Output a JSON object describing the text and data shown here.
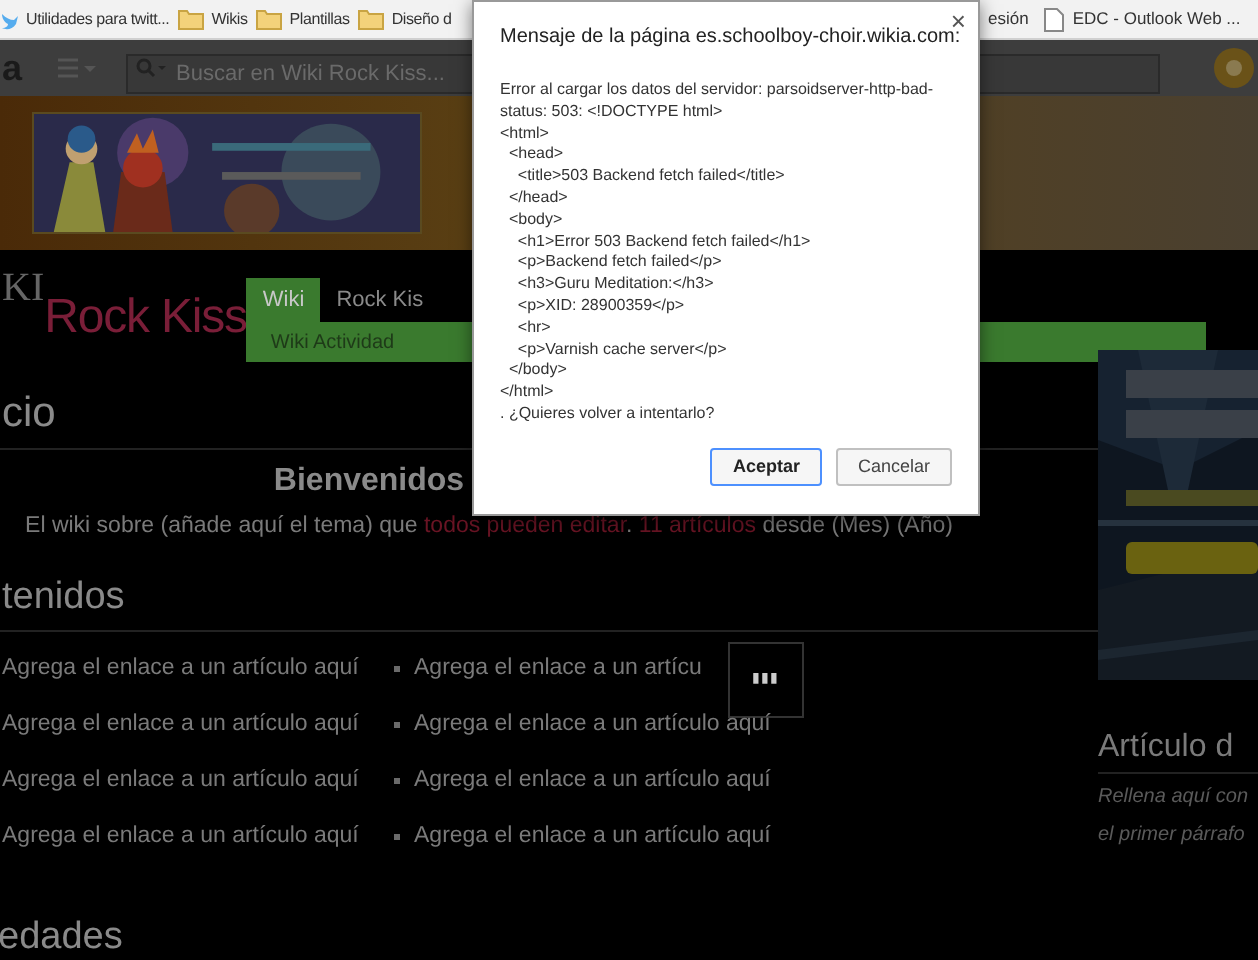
{
  "bookmarks": [
    {
      "kind": "bird",
      "label": "Utilidades para twitt..."
    },
    {
      "kind": "folder",
      "label": "Wikis"
    },
    {
      "kind": "folder",
      "label": "Plantillas"
    },
    {
      "kind": "folder",
      "label": "Diseño d"
    },
    {
      "kind": "text",
      "label": "esión"
    },
    {
      "kind": "page",
      "label": "EDC - Outlook Web ..."
    }
  ],
  "toolbar": {
    "logo": "a",
    "search": {
      "placeholder": "Buscar en Wiki Rock Kiss..."
    }
  },
  "wiki": {
    "logo_prefix": "KI",
    "logo": "Rock Kiss",
    "tabs": [
      {
        "label": "Wiki",
        "selected": true
      },
      {
        "label": "Rock Kis",
        "selected": false
      }
    ],
    "subnav": [
      "Wiki Actividad"
    ]
  },
  "page_title": "cio",
  "welcome": {
    "title": "Bienvenidos",
    "parts": [
      {
        "kind": "text",
        "text": "El wiki sobre (añade aquí el tema) que "
      },
      {
        "kind": "link",
        "text": "todos pueden editar"
      },
      {
        "kind": "text",
        "text": ". "
      },
      {
        "kind": "link",
        "text": "11 artículos"
      },
      {
        "kind": "text",
        "text": " desde (Mes) (Año)"
      }
    ]
  },
  "contents": {
    "heading": "tenidos",
    "column_1": [
      "Agrega el enlace a un artículo aquí",
      "Agrega el enlace a un artículo aquí",
      "Agrega el enlace a un artículo aquí",
      "Agrega el enlace a un artículo aquí"
    ],
    "column_2": [
      "Agrega el enlace a un artícu",
      "Agrega el enlace a un artículo aquí",
      "Agrega el enlace a un artículo aquí",
      "Agrega el enlace a un artículo aquí"
    ]
  },
  "loading": "▮▮▮",
  "news_heading": "edades",
  "sidebar": {
    "heading": "Artículo d",
    "lines": [
      "Rellena aquí con",
      "el primer párrafo"
    ]
  },
  "dialog": {
    "title": "Mensaje de la página es.schoolboy-choir.wikia.com:",
    "close": "×",
    "lines": [
      "Error al cargar los datos del servidor: parsoidserver-http-bad-status: 503: <!DOCTYPE html>",
      "<html>",
      "  <head>",
      "    <title>503 Backend fetch failed</title>",
      "  </head>",
      "  <body>",
      "    <h1>Error 503 Backend fetch failed</h1>",
      "    <p>Backend fetch failed</p>",
      "    <h3>Guru Meditation:</h3>",
      "    <p>XID: 28900359</p>",
      "    <hr>",
      "    <p>Varnish cache server</p>",
      "  </body>",
      "</html>",
      ". ¿Quieres volver a intentarlo?"
    ],
    "buttons": [
      {
        "label": "Aceptar",
        "kind": "primary"
      },
      {
        "label": "Cancelar",
        "kind": "secondary"
      }
    ]
  }
}
